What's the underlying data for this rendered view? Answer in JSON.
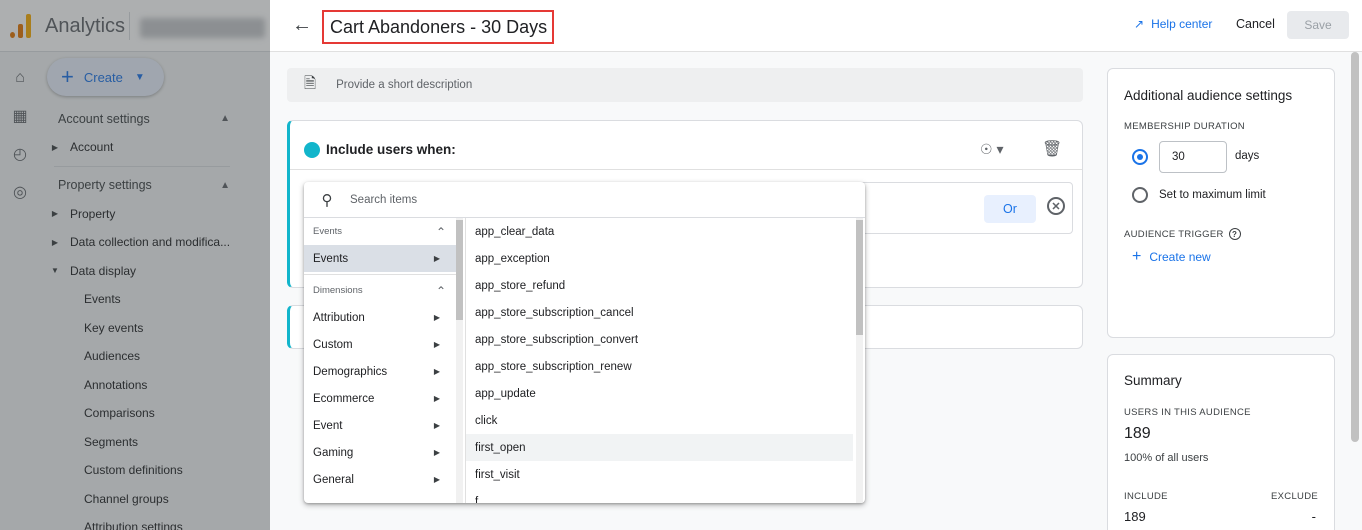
{
  "app": {
    "name": "Analytics",
    "create_label": "Create"
  },
  "nav": {
    "account_settings": "Account settings",
    "account": "Account",
    "property_settings": "Property settings",
    "property": "Property",
    "data_collection": "Data collection and modifica...",
    "data_display": "Data display",
    "sub_items": [
      "Events",
      "Key events",
      "Audiences",
      "Annotations",
      "Comparisons",
      "Segments",
      "Custom definitions",
      "Channel groups",
      "Attribution settings"
    ]
  },
  "editor": {
    "title": "Cart Abandoners - 30 Days",
    "help_center": "Help center",
    "cancel": "Cancel",
    "save": "Save",
    "description_placeholder": "Provide a short description",
    "include_title": "Include users when:",
    "or_label": "Or"
  },
  "dropdown": {
    "search_placeholder": "Search items",
    "categories": {
      "events_header": "Events",
      "events_option": "Events",
      "dimensions_header": "Dimensions",
      "dimension_options": [
        "Attribution",
        "Custom",
        "Demographics",
        "Ecommerce",
        "Event",
        "Gaming",
        "General"
      ]
    },
    "items": [
      "app_clear_data",
      "app_exception",
      "app_store_refund",
      "app_store_subscription_cancel",
      "app_store_subscription_convert",
      "app_store_subscription_renew",
      "app_update",
      "click",
      "first_open",
      "first_visit",
      "f"
    ]
  },
  "settings": {
    "title": "Additional audience settings",
    "membership_duration": "MEMBERSHIP DURATION",
    "duration_value": "30",
    "days": "days",
    "max_limit": "Set to maximum limit",
    "audience_trigger": "AUDIENCE TRIGGER",
    "create_new": "Create new"
  },
  "summary": {
    "title": "Summary",
    "users_label": "USERS IN THIS AUDIENCE",
    "users_count": "189",
    "users_pct": "100% of all users",
    "include_label": "INCLUDE",
    "exclude_label": "EXCLUDE",
    "include_value": "189",
    "exclude_value": "-"
  }
}
